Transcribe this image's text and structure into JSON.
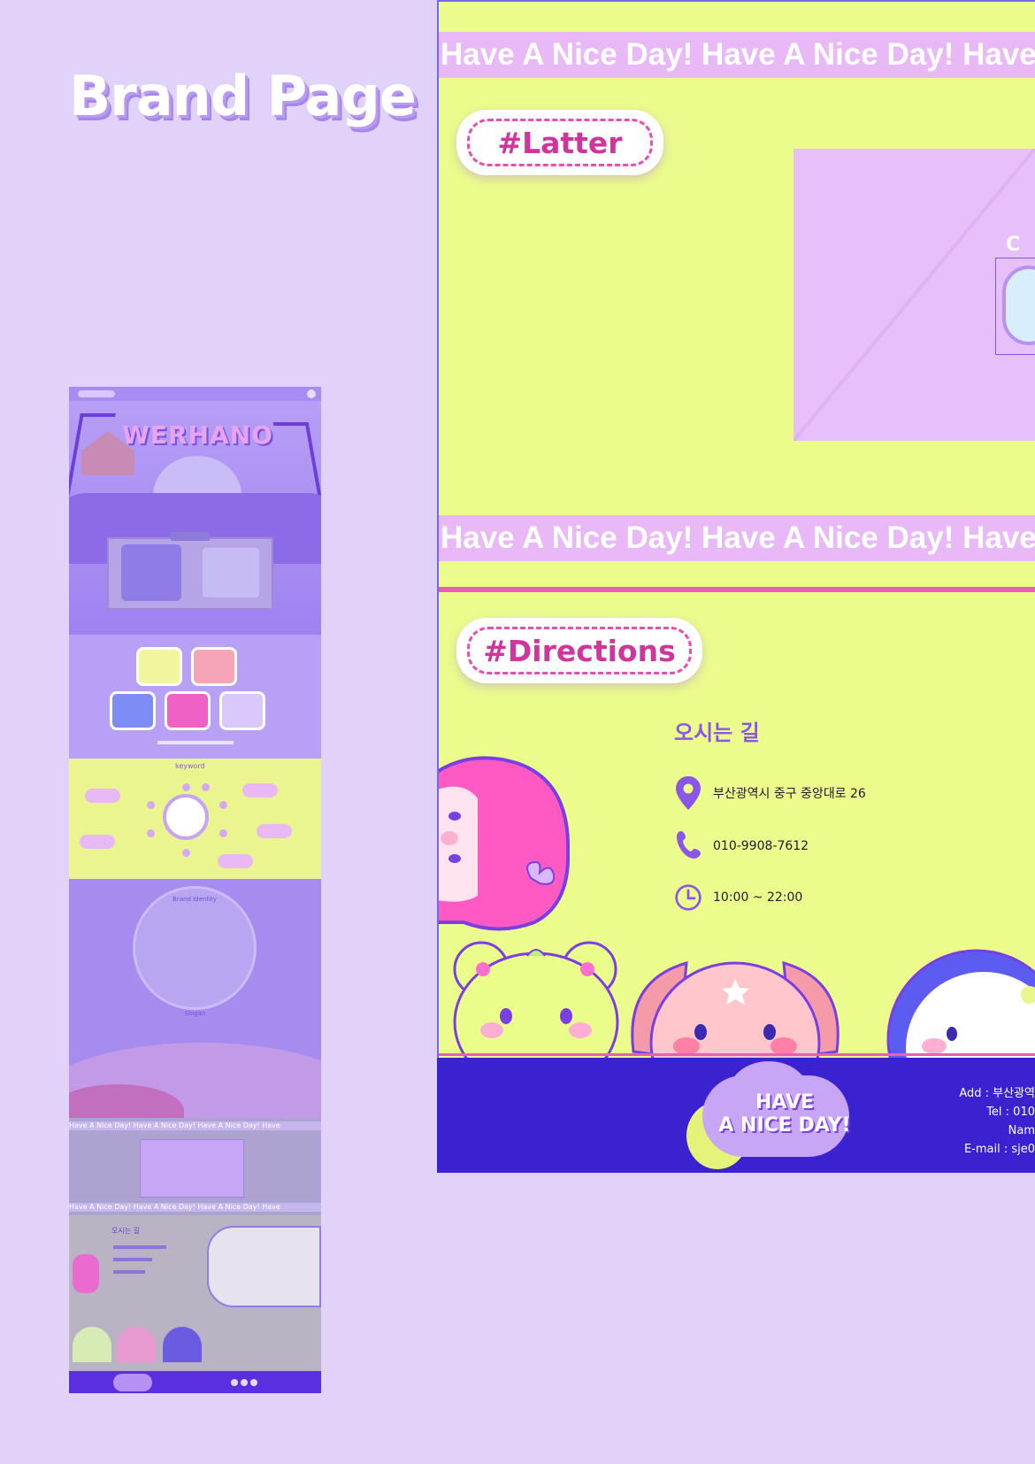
{
  "page": {
    "title": "Brand Page"
  },
  "preview": {
    "hero_title": "WERHANO",
    "keyword_label": "keyword",
    "brand_identity_label": "Brand Identity",
    "slogan_label": "Slogan",
    "marquee": "Have A Nice Day! Have A Nice Day! Have A Nice Day! Have",
    "directions_title": "오시는 길",
    "colors": {
      "hero": "#b09af5",
      "keyword_bg": "#eaf58f",
      "footer": "#5a2fe0"
    }
  },
  "zoom": {
    "marquee_text": "Have A Nice Day! Have A Nice Day! Have A Nice Day!",
    "latter_label": "#Latter",
    "envelope_click": "C",
    "directions_label": "#Directions",
    "directions": {
      "title": "오시는 길",
      "address": "부산광역시 중구 중앙대로 26",
      "phone": "010-9908-7612",
      "hours": "10:00 ~ 22:00"
    },
    "footer": {
      "logo_line1": "HAVE",
      "logo_line2": "A NICE DAY!",
      "add": "Add : 부산광역",
      "tel": "Tel : 010",
      "name": "Nam",
      "email": "E-mail : sje0"
    },
    "icons": [
      "map-pin-icon",
      "phone-icon",
      "clock-icon"
    ],
    "colors": {
      "page_bg": "#ebfb8c",
      "accent_pink": "#e94fae",
      "marquee_bg": "#e8b8f7",
      "footer_bg": "#3a22d0",
      "heading_purple": "#8a56e6"
    }
  }
}
